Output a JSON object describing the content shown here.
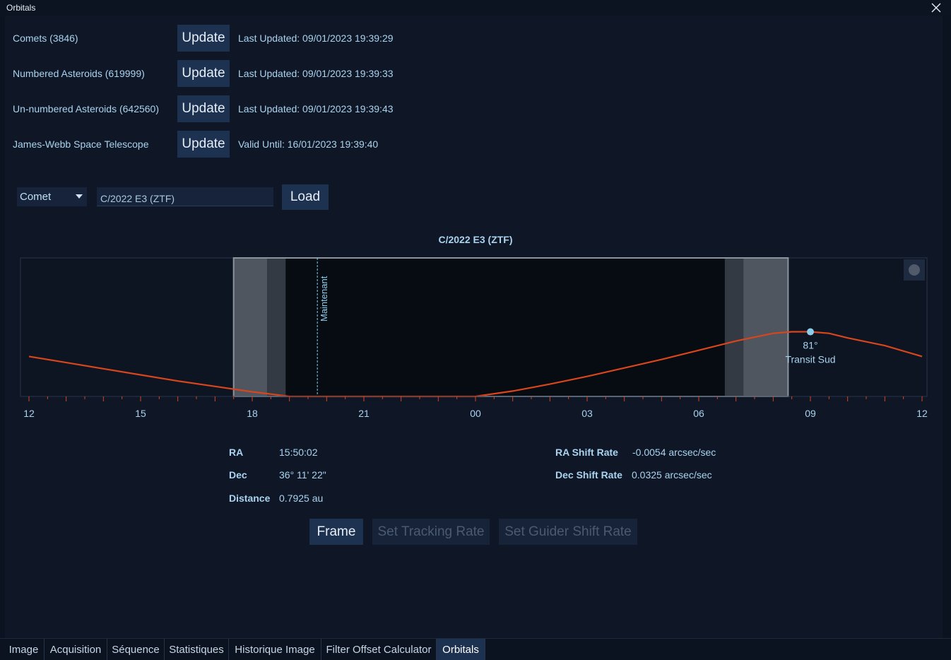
{
  "window": {
    "title": "Orbitals"
  },
  "sources": [
    {
      "label": "Comets (3846)",
      "button": "Update",
      "status": "Last Updated: 09/01/2023 19:39:29"
    },
    {
      "label": "Numbered Asteroids (619999)",
      "button": "Update",
      "status": "Last Updated: 09/01/2023 19:39:33"
    },
    {
      "label": "Un-numbered Asteroids (642560)",
      "button": "Update",
      "status": "Last Updated: 09/01/2023 19:39:43"
    },
    {
      "label": "James-Webb Space Telescope",
      "button": "Update",
      "status": "Valid Until: 16/01/2023 19:39:40"
    }
  ],
  "search": {
    "type_selected": "Comet",
    "object_value": "C/2022 E3 (ZTF)",
    "load_label": "Load"
  },
  "chart_data": {
    "type": "line",
    "title": "C/2022 E3 (ZTF)",
    "x_tick_labels": [
      "12",
      "15",
      "18",
      "21",
      "00",
      "03",
      "06",
      "09",
      "12"
    ],
    "x_tick_hours_from_start": [
      0,
      3,
      6,
      9,
      12,
      15,
      18,
      21,
      24
    ],
    "altitude_series": {
      "hours_from_start": [
        0,
        1,
        2,
        3,
        4,
        5,
        6,
        6.5,
        7,
        12,
        13,
        14,
        15,
        16,
        17,
        18,
        19,
        20,
        20.5,
        21.0,
        21.5,
        22,
        23,
        24
      ],
      "altitude_deg": [
        26,
        22,
        18,
        14,
        10,
        6.5,
        3.0,
        1.5,
        0,
        0,
        3.5,
        8,
        13,
        18.5,
        24,
        30,
        36,
        41,
        42,
        42,
        41,
        38,
        33,
        26
      ]
    },
    "altitude_range_deg": [
      0,
      90
    ],
    "now_label": "Maintenant",
    "now_hours_from_start": 7.75,
    "twilight_bands": {
      "evening_civil_end": 6.4,
      "evening_nautical_end": 6.9,
      "morning_nautical_start": 18.7,
      "morning_civil_start": 19.2
    },
    "dusk_hours_from_start": 5.5,
    "dawn_hours_from_start": 20.4,
    "transit": {
      "hours_from_start": 21.0,
      "altitude_label": "81°",
      "label": "Transit Sud"
    },
    "colors": {
      "curve": "#d9451c",
      "night": "#070b12",
      "twilight_dark": "#343a44",
      "twilight_light": "#4f5660",
      "accent": "#8ecdea"
    }
  },
  "info": {
    "ra_label": "RA",
    "ra_value": "15:50:02",
    "dec_label": "Dec",
    "dec_value": "36° 11' 22\"",
    "distance_label": "Distance",
    "distance_value": "0.7925 au",
    "ra_rate_label": "RA Shift Rate",
    "ra_rate_value": "-0.0054 arcsec/sec",
    "dec_rate_label": "Dec Shift Rate",
    "dec_rate_value": "0.0325 arcsec/sec"
  },
  "actions": {
    "frame": "Frame",
    "set_tracking": "Set Tracking Rate",
    "set_guider": "Set Guider Shift Rate"
  },
  "tabs": [
    "Image",
    "Acquisition",
    "Séquence",
    "Statistiques",
    "Historique Image",
    "Filter Offset Calculator",
    "Orbitals"
  ],
  "active_tab": "Orbitals"
}
